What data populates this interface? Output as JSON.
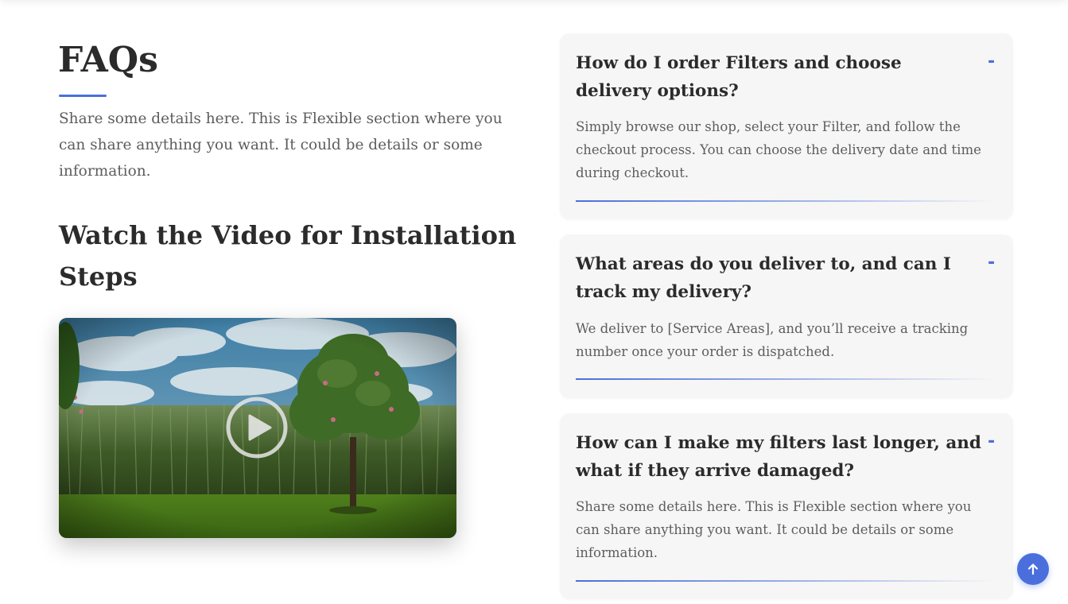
{
  "faq_section": {
    "title": "FAQs",
    "intro": "Share some details here. This is Flexible section where you can share anything you want. It could be details or some information.",
    "video_heading": "Watch the Video for Installation Steps",
    "video": {
      "thumbnail": "field-with-tree-landscape",
      "play_icon": "play-icon"
    }
  },
  "faqs": [
    {
      "question": "How do I order Filters and choose delivery options?",
      "answer": "Simply browse our shop, select your Filter, and follow the checkout process. You can choose the delivery date and time during checkout.",
      "toggle": "-"
    },
    {
      "question": "What areas do you deliver to, and can I track my delivery?",
      "answer": "We deliver to [Service Areas], and you’ll receive a tracking number once your order is dispatched.",
      "toggle": "-"
    },
    {
      "question": "How can I make my filters last longer, and what if they arrive damaged?",
      "answer": "Share some details here. This is Flexible section where you can share anything you want. It could be details or some information.",
      "toggle": "-"
    }
  ],
  "scroll_top": {
    "icon": "arrow-up-icon"
  },
  "colors": {
    "accent": "#4a6fdc",
    "heading": "#2b2b2b",
    "body_text": "#5d5d5d",
    "card_bg": "#f6f6f6"
  }
}
